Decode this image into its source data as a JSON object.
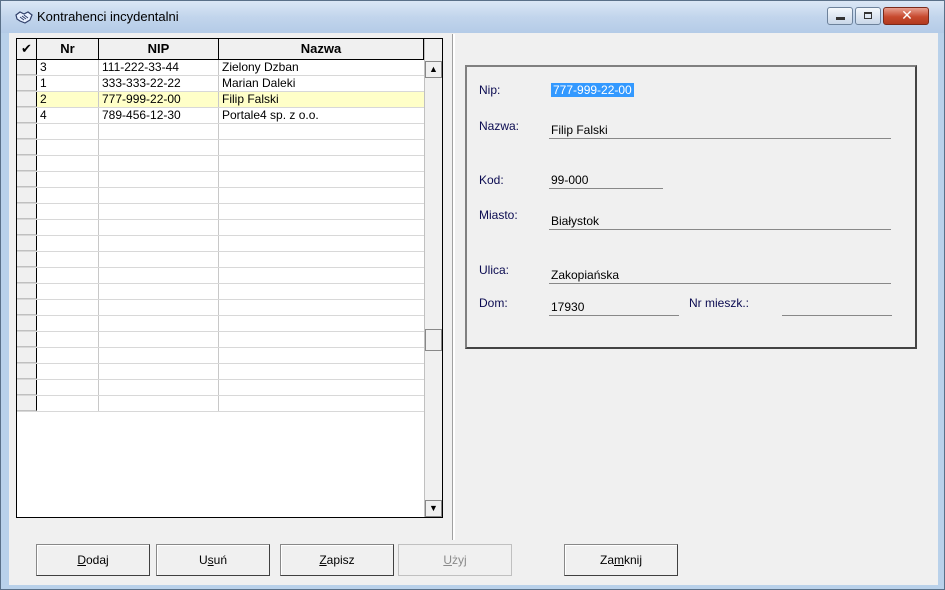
{
  "window": {
    "title": "Kontrahenci incydentalni",
    "close_glyph": "✕"
  },
  "grid": {
    "columns": [
      {
        "key": "sel",
        "label": "✔"
      },
      {
        "key": "nr",
        "label": "Nr"
      },
      {
        "key": "nip",
        "label": "NIP"
      },
      {
        "key": "nazwa",
        "label": "Nazwa"
      }
    ],
    "rows": [
      {
        "nr": "3",
        "nip": "111-222-33-44",
        "nazwa": "Zielony Dzban"
      },
      {
        "nr": "1",
        "nip": "333-333-22-22",
        "nazwa": "Marian Daleki"
      },
      {
        "nr": "2",
        "nip": "777-999-22-00",
        "nazwa": "Filip Falski"
      },
      {
        "nr": "4",
        "nip": "789-456-12-30",
        "nazwa": "Portale4 sp. z o.o."
      }
    ],
    "selected_row": 2,
    "empty_row_count": 18
  },
  "detail": {
    "nip_label": "Nip:",
    "nip_value": "777-999-22-00",
    "nazwa_label": "Nazwa:",
    "nazwa_value": "Filip Falski",
    "kod_label": "Kod:",
    "kod_value": "99-000",
    "miasto_label": "Miasto:",
    "miasto_value": "Białystok",
    "ulica_label": "Ulica:",
    "ulica_value": "Zakopiańska",
    "dom_label": "Dom:",
    "dom_value": "17930",
    "mieszk_label": "Nr mieszk.:",
    "mieszk_value": ""
  },
  "buttons": {
    "dodaj": {
      "pre": "",
      "ul": "D",
      "post": "odaj"
    },
    "usun": {
      "pre": "U",
      "ul": "s",
      "post": "uń"
    },
    "zapisz": {
      "pre": "",
      "ul": "Z",
      "post": "apisz"
    },
    "uzyj": {
      "pre": "",
      "ul": "U",
      "post": "żyj"
    },
    "zamknij": {
      "pre": "Za",
      "ul": "m",
      "post": "knij"
    }
  },
  "colors": {
    "selected_row_bg": "#ffffc8",
    "nip_highlight": "#3399ff"
  }
}
